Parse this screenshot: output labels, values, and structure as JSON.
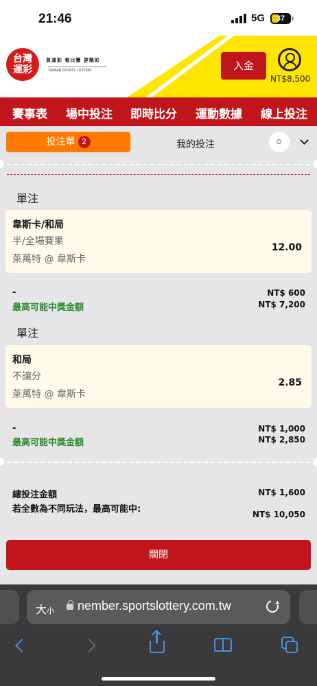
{
  "status_bar": {
    "time": "21:46",
    "network": "5G",
    "battery": "37"
  },
  "header": {
    "logo_line1": "台灣",
    "logo_line2": "運彩",
    "logo_tagline": "買運彩 看比賽 更精彩",
    "logo_subtitle": "TAIWAN SPORTS LOTTERY",
    "deposit_label": "入金",
    "balance": "NT$8,500",
    "brand_color": "#c0161b",
    "accent_color": "#ffe600"
  },
  "nav": {
    "items": [
      {
        "label": "賽事表"
      },
      {
        "label": "場中投注"
      },
      {
        "label": "即時比分"
      },
      {
        "label": "運動數據"
      },
      {
        "label": "線上投注"
      }
    ]
  },
  "tabs": {
    "bet_slip_label": "投注單",
    "bet_slip_count": "2",
    "my_bets_label": "我的投注",
    "active_color": "#ff7a00"
  },
  "bets": [
    {
      "section_title": "單注",
      "selection": "韋斯卡/和局",
      "market": "半/全場賽果",
      "match": "萊萬特 @ 韋斯卡",
      "odds": "12.00",
      "stake_label": "-",
      "stake": "NT$ 600",
      "max_win_label": "最高可能中獎金額",
      "max_win": "NT$ 7,200"
    },
    {
      "section_title": "單注",
      "selection": "和局",
      "market": "不讓分",
      "match": "萊萬特 @ 韋斯卡",
      "odds": "2.85",
      "stake_label": "-",
      "stake": "NT$ 1,000",
      "max_win_label": "最高可能中獎金額",
      "max_win": "NT$ 2,850"
    }
  ],
  "summary": {
    "total_label": "總投注金額",
    "total_value": "NT$ 1,600",
    "if_all_label": "若全數為不同玩法，最高可能中:",
    "if_all_value": "NT$ 10,050",
    "win_label_color": "#2e8b2e"
  },
  "close_button": "關閉",
  "browser": {
    "text_size_label": "大",
    "text_size_small": "小",
    "url": "member.sportslottery.com.tw",
    "url_visible": "nember.sportslottery.com.tw"
  }
}
